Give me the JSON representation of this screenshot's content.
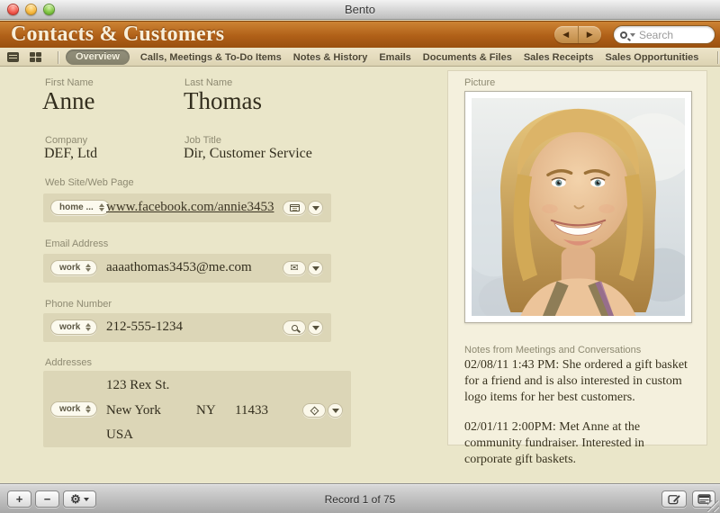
{
  "window": {
    "title": "Bento"
  },
  "header": {
    "title": "Contacts & Customers",
    "search_placeholder": "Search"
  },
  "tabbar": {
    "selected_index": 0,
    "tabs": [
      "Overview",
      "Calls, Meetings & To-Do Items",
      "Notes & History",
      "Emails",
      "Documents & Files",
      "Sales Receipts",
      "Sales Opportunities"
    ]
  },
  "form": {
    "first_name": {
      "label": "First Name",
      "value": "Anne"
    },
    "last_name": {
      "label": "Last Name",
      "value": "Thomas"
    },
    "company": {
      "label": "Company",
      "value": "DEF, Ltd"
    },
    "job_title": {
      "label": "Job Title",
      "value": "Dir, Customer Service"
    },
    "website": {
      "label": "Web Site/Web Page",
      "type": "home ...",
      "value": "www.facebook.com/annie3453"
    },
    "email": {
      "label": "Email Address",
      "type": "work",
      "value": "aaaathomas3453@me.com"
    },
    "phone": {
      "label": "Phone Number",
      "type": "work",
      "value": "212-555-1234"
    },
    "address": {
      "label": "Addresses",
      "type": "work",
      "street": "123 Rex St.",
      "city": "New York",
      "state": "NY",
      "zip": "11433",
      "country": "USA"
    }
  },
  "picture": {
    "label": "Picture"
  },
  "notes": {
    "label": "Notes from Meetings and Conversations",
    "entries": [
      "02/08/11 1:43 PM: She ordered a gift basket for a friend and is also interested in custom logo items for her best customers.",
      "02/01/11 2:00PM: Met Anne at the community fundraiser. Interested in corporate gift baskets."
    ]
  },
  "statusbar": {
    "record_counter": "Record 1 of 75"
  },
  "icons": {
    "back": "◀",
    "forward": "▶",
    "plus": "+",
    "minus": "−",
    "envelope": "✉",
    "gear": "⚙"
  },
  "colors": {
    "header_orange_top": "#cd8434",
    "header_orange_bottom": "#99500f",
    "page_bg": "#eae6c9",
    "panel_bg": "#f4f0dd",
    "row_bg": "#dcd6b7"
  }
}
